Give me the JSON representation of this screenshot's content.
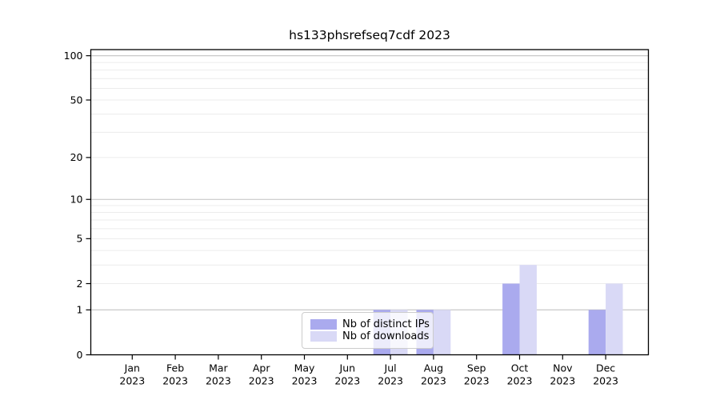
{
  "chart_data": {
    "type": "bar",
    "title": "hs133phsrefseq7cdf 2023",
    "categories": [
      "Jan",
      "Feb",
      "Mar",
      "Apr",
      "May",
      "Jun",
      "Jul",
      "Aug",
      "Sep",
      "Oct",
      "Nov",
      "Dec"
    ],
    "xtick_year": "2023",
    "series": [
      {
        "name": "Nb of distinct IPs",
        "color": "#aaaaee",
        "values": [
          0,
          0,
          0,
          0,
          0,
          0,
          1,
          1,
          0,
          2,
          0,
          1
        ]
      },
      {
        "name": "Nb of downloads",
        "color": "#d9d9f6",
        "values": [
          0,
          0,
          0,
          0,
          0,
          0,
          1,
          1,
          0,
          3,
          0,
          2
        ]
      }
    ],
    "yscale": "log1p",
    "ylim": [
      0,
      110
    ],
    "yticks": [
      0,
      1,
      2,
      5,
      10,
      20,
      50,
      100
    ],
    "gridlines": {
      "major": [
        1,
        10,
        100
      ],
      "minor": [
        2,
        3,
        4,
        5,
        6,
        7,
        8,
        9,
        20,
        30,
        40,
        50,
        60,
        70,
        80,
        90
      ]
    },
    "legend_position": "lower center",
    "grid_on": true,
    "colors": {
      "major_grid": "#c2c2c2",
      "minor_grid": "#ececec",
      "axis": "#000000",
      "text": "#000000"
    }
  }
}
